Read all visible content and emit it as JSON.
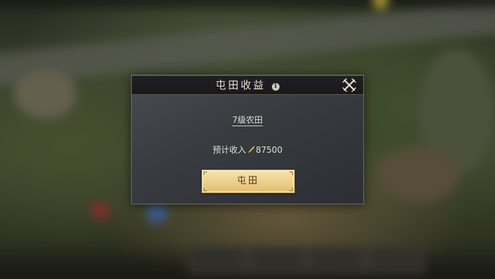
{
  "dialog": {
    "title": "屯田收益",
    "info_glyph": "i",
    "level_label": "7级农田",
    "income_label": "预计收入",
    "income_value": "87500",
    "resource_icon": "grain-icon",
    "confirm_label": "屯田"
  },
  "colors": {
    "panel": "#3a3c42",
    "header": "#1f2024",
    "button_gold": "#eed391",
    "text": "#e2ddd2"
  }
}
